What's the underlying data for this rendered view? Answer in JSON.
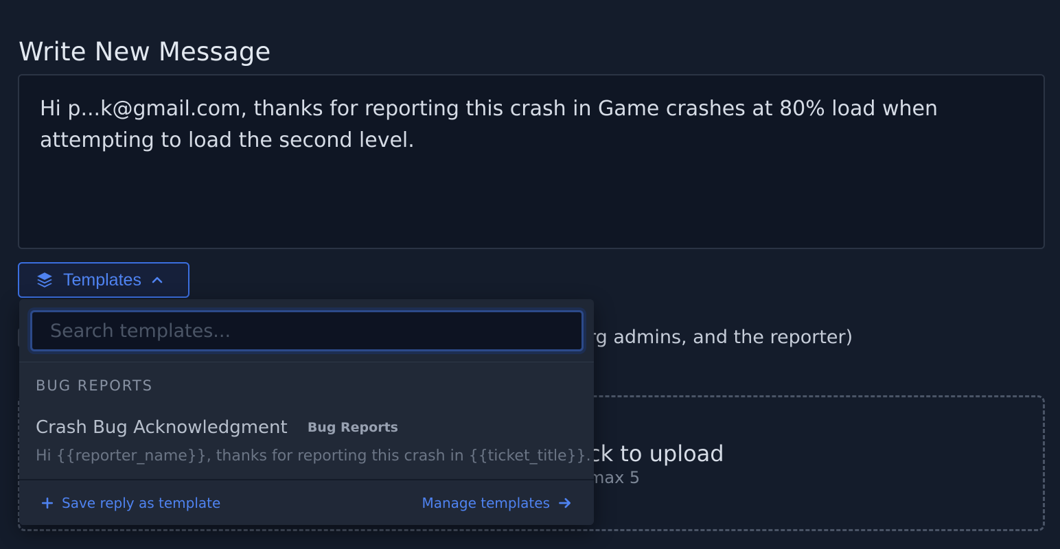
{
  "heading": "Write New Message",
  "message": {
    "text": "Hi p...k@gmail.com, thanks for reporting this crash in Game crashes at 80% load when attempting to load the second level."
  },
  "templates_button": {
    "label": "Templates",
    "icon": "layers-icon",
    "chevron": "chevron-up-icon"
  },
  "background": {
    "visibility_text": "rg admins, and the reporter)",
    "upload_title": "ck to upload",
    "upload_sub": "max 5"
  },
  "dropdown": {
    "search": {
      "value": "",
      "placeholder": "Search templates..."
    },
    "group_label": "BUG REPORTS",
    "items": [
      {
        "name": "Crash Bug Acknowledgment",
        "tag": "Bug Reports",
        "preview": "Hi {{reporter_name}}, thanks for reporting this crash in {{ticket_title}}."
      }
    ],
    "footer": {
      "save_label": "Save reply as template",
      "manage_label": "Manage templates"
    }
  },
  "colors": {
    "accent": "#4f83f1",
    "background": "#141c2b",
    "panel": "#212937"
  }
}
